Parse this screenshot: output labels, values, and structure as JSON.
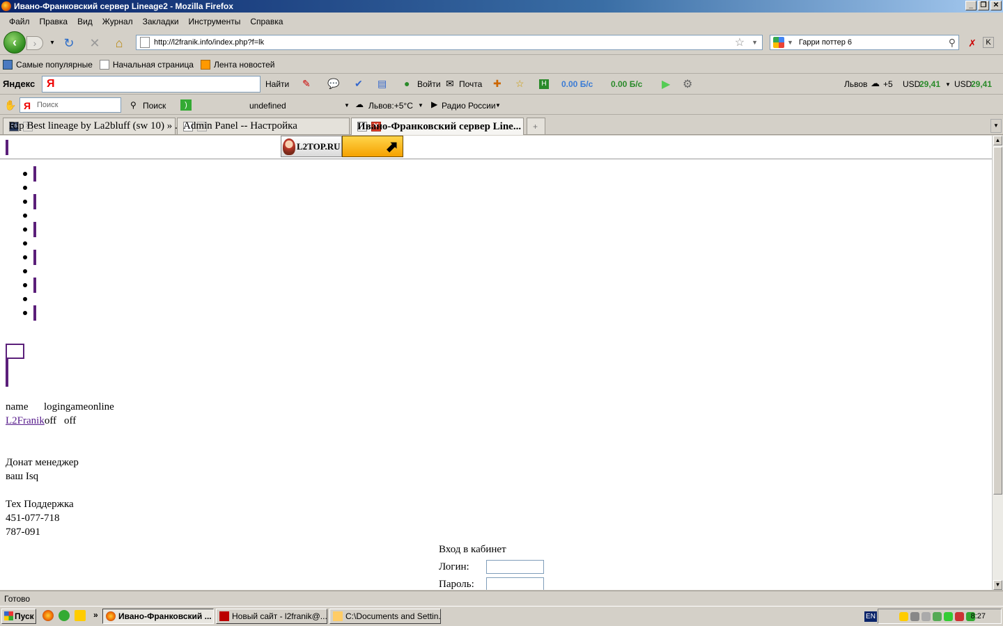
{
  "window": {
    "title": "Ивано-Франковский сервер Lineage2 - Mozilla Firefox"
  },
  "menu": [
    "Файл",
    "Правка",
    "Вид",
    "Журнал",
    "Закладки",
    "Инструменты",
    "Справка"
  ],
  "nav": {
    "url": "http://l2franik.info/index.php?f=lk",
    "search_value": "Гарри поттер 6"
  },
  "bookmarks": [
    "Самые популярные",
    "Начальная страница",
    "Лента новостей"
  ],
  "yandex_bar": {
    "logo": "Яндекс",
    "find_label": "Найти",
    "login_label": "Войти",
    "mail_label": "Почта",
    "speed_down": "0.00 Б/с",
    "speed_up": "0.00 Б/с",
    "city": "Львов",
    "temp": "+5",
    "usd1_label": "USD",
    "usd1_value": "29,41",
    "usd2_label": "USD",
    "usd2_value": "29,41"
  },
  "yandex_bar2": {
    "search_placeholder": "Поиск",
    "search_btn": "Поиск",
    "undefined_label": "undefined",
    "weather": "Львов:+5°C",
    "radio": "Радио России"
  },
  "tabs": [
    {
      "label": "Rip Best lineage by La2bluff (sw 10) » ...",
      "active": false
    },
    {
      "label": "Admin Panel -- Настройка",
      "active": false
    },
    {
      "label": "Ивано-Франковский сервер Line...",
      "active": true
    }
  ],
  "page": {
    "banner_text": "L2TOP.RU",
    "status_header_name": "name",
    "status_header_login": "logingameonline",
    "server_name": "L2Franik",
    "login_status": "off",
    "game_status": "off",
    "donate_title": "Донат менеджер",
    "donate_isq": "ваш Isq",
    "support_title": "Тех Поддержка",
    "support_1": "451-077-718",
    "support_2": "787-091",
    "login_title": "Вход в кабинет",
    "login_label": "Логин:",
    "password_label": "Пароль:"
  },
  "status": "Готово",
  "taskbar": {
    "start": "Пуск",
    "items": [
      "Ивано-Франковский ...",
      "Новый сайт - l2franik@...",
      "C:\\Documents and Settin..."
    ],
    "lang": "EN",
    "time": "8:27"
  }
}
